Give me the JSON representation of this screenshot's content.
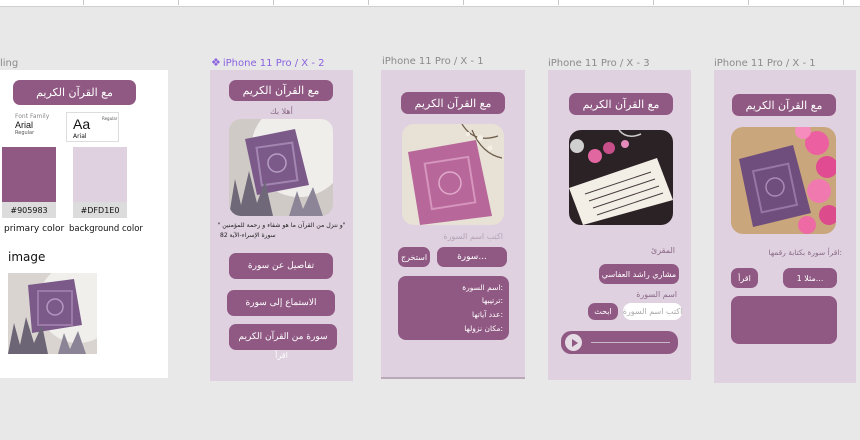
{
  "canvas": {
    "frame_label_left": "ling",
    "bg_color": "#e8e8e8"
  },
  "app": {
    "title": "مع القرآن الكريم"
  },
  "style_board": {
    "font_family_caption": "Font Family",
    "font_name": "Arial",
    "font_weight": "Regular",
    "aa_sample": "Aa",
    "aa_weight": "Regular",
    "aa_font": "Arial",
    "primary_hex": "#905983",
    "background_hex": "#DFD1E0",
    "primary_label": "primary color",
    "background_label": "background color",
    "image_label": "image"
  },
  "frames": [
    {
      "label": "iPhone 11 Pro / X - 2",
      "greeting": "أهلا بك",
      "verse": "\" و ننزل من القرآن ما هو شفاء و رحمة للمؤمنين\"",
      "verse_ref": "سورة الإسراء-الآية 82",
      "buttons": [
        "تفاصيل عن سورة",
        "الاستماع إلى سورة",
        "سورة من القرآن الكريم"
      ],
      "footer_text": "اقرأ"
    },
    {
      "label": "iPhone 11 Pro / X - 1",
      "input_hint": "اكتب اسم السورة",
      "input_value": "سورة...",
      "extract_button": "استخرج",
      "fields": [
        "اسم السورة:",
        "ترتيبها:",
        "عدد آياتها:",
        "مكان نزولها:"
      ]
    },
    {
      "label": "iPhone 11 Pro / X - 3",
      "reciter_label": "المقرئ",
      "reciter_value": "مشاري راشد العفاسي",
      "surah_label": "اسم السورة",
      "surah_placeholder": "اكتب اسم السورة",
      "search_button": "ابحث"
    },
    {
      "label": "iPhone 11 Pro / X - 1",
      "prompt": "اقرأ سورة بكتابة رقمها:",
      "input_value": "مثلا 1...",
      "read_button": "اقرأ"
    }
  ],
  "colors": {
    "primary": "#905983",
    "background": "#DFD1E0"
  },
  "icons": {
    "component": "component-icon",
    "play": "play-icon"
  }
}
